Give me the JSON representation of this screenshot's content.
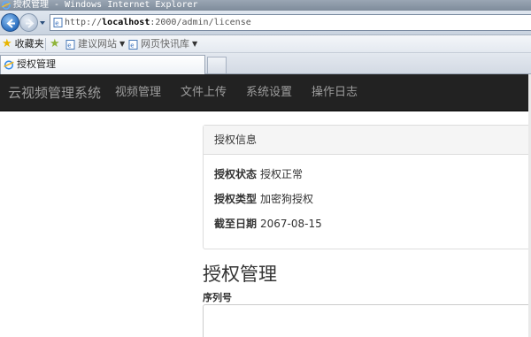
{
  "browser": {
    "window_title": "授权管理",
    "window_title_suffix": " - Windows Internet Explorer",
    "url_prefix": "http://",
    "url_host": "localhost",
    "url_rest": ":2000/admin/license",
    "favorites_label": "收藏夹",
    "favorites": [
      {
        "label": "建议网站",
        "icon": "ie-page-icon"
      },
      {
        "label": "网页快讯库",
        "icon": "ie-page-icon"
      }
    ],
    "tab_title": "授权管理"
  },
  "navbar": {
    "brand": "云视频管理系统",
    "links": [
      "视频管理",
      "文件上传",
      "系统设置",
      "操作日志"
    ],
    "background": "#222222",
    "text_color": "#9d9d9d"
  },
  "license_panel": {
    "heading": "授权信息",
    "rows": [
      {
        "label": "授权状态",
        "value": "授权正常"
      },
      {
        "label": "授权类型",
        "value": "加密狗授权"
      },
      {
        "label": "截至日期",
        "value": "2067-08-15"
      }
    ]
  },
  "license_management": {
    "title": "授权管理",
    "serial_label": "序列号",
    "serial_value": ""
  }
}
